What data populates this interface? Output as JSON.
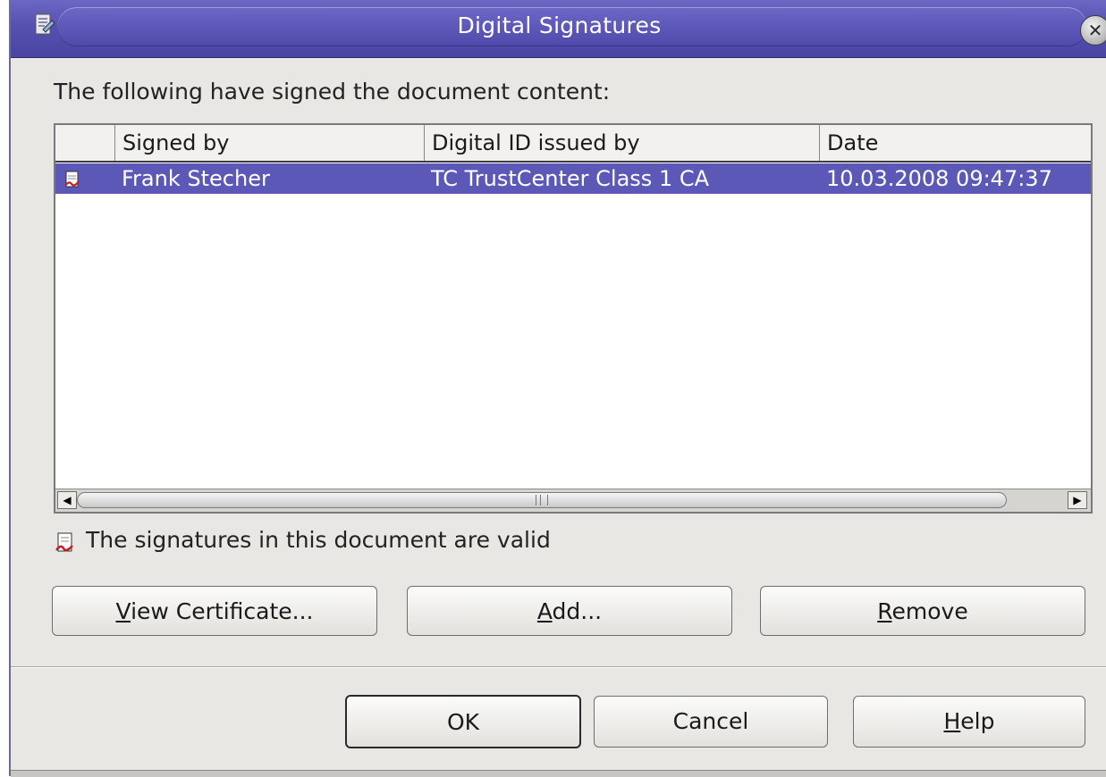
{
  "window": {
    "title": "Digital Signatures"
  },
  "heading": "The following have signed the document content:",
  "list": {
    "columns": [
      "",
      "Signed by",
      "Digital ID issued by",
      "Date"
    ],
    "rows": [
      {
        "signed_by": "Frank Stecher",
        "issued_by": "TC TrustCenter Class 1 CA",
        "date": "10.03.2008 09:47:37",
        "selected": true
      }
    ]
  },
  "status": {
    "text": "The signatures in this document are valid",
    "icon": "signature-valid-icon"
  },
  "buttons": {
    "view_certificate": {
      "mnemonic": "V",
      "rest": "iew Certificate..."
    },
    "add": {
      "mnemonic": "A",
      "rest": "dd..."
    },
    "remove": {
      "mnemonic": "R",
      "rest": "emove"
    },
    "ok": "OK",
    "cancel": "Cancel",
    "help": {
      "mnemonic": "H",
      "rest": "elp"
    }
  },
  "colors": {
    "titlebar": "#5651b0",
    "selection": "#5c58b8",
    "dialog_bg": "#e9e7e3"
  }
}
